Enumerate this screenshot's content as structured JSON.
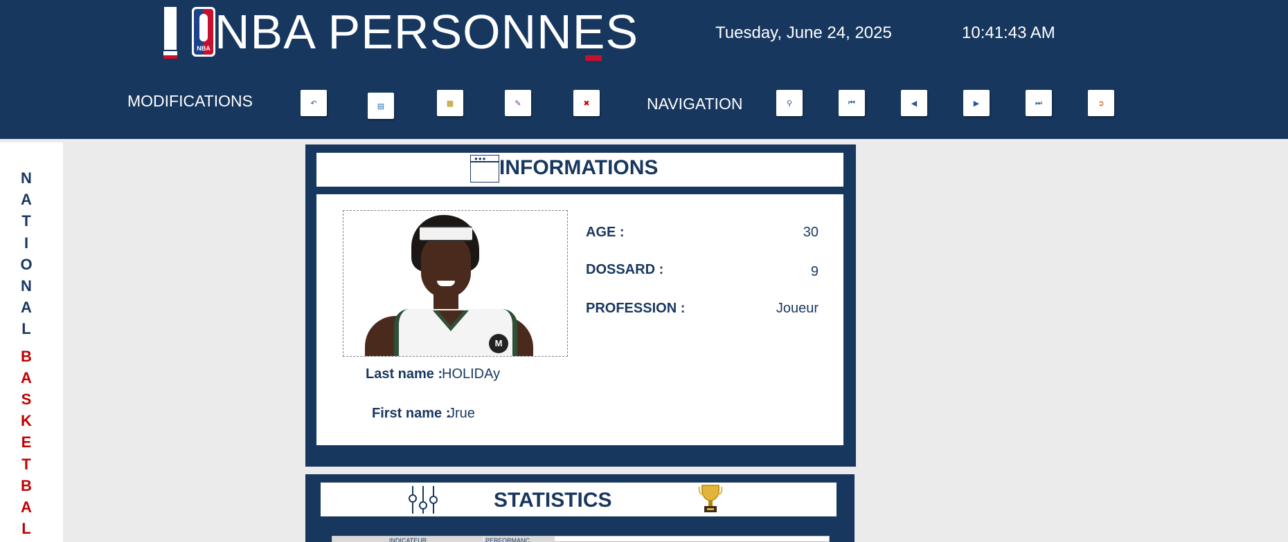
{
  "header": {
    "brand": "NBA PERSONNES",
    "logo_text": "NBA",
    "date": "Tuesday, June 24, 2025",
    "time": "10:41:43 AM"
  },
  "toolbar": {
    "modifications_label": "MODIFICATIONS",
    "navigation_label": "NAVIGATION",
    "mod_buttons": [
      "undo-icon",
      "save-icon",
      "add-record-icon",
      "edit-record-icon",
      "delete-record-icon"
    ],
    "nav_buttons": [
      "search-icon",
      "first-record-icon",
      "previous-record-icon",
      "next-record-icon",
      "last-record-icon",
      "exit-icon"
    ]
  },
  "sidebar": {
    "word1": [
      "N",
      "A",
      "T",
      "I",
      "O",
      "N",
      "A",
      "L"
    ],
    "word2": [
      "B",
      "A",
      "S",
      "K",
      "E",
      "T",
      "B",
      "A",
      "L"
    ]
  },
  "informations": {
    "title": "INFORMATIONS",
    "age_label": "AGE :",
    "age_value": "30",
    "dossard_label": "DOSSARD :",
    "dossard_value": "9",
    "profession_label": "PROFESSION :",
    "profession_value": "Joueur",
    "lastname_label": "Last name :",
    "lastname_value": "HOLIDAy",
    "firstname_label": "First name :",
    "firstname_value": "Jrue"
  },
  "statistics": {
    "title": "STATISTICS",
    "columns": [
      "INDICATEUR",
      "PERFORMANC"
    ]
  }
}
